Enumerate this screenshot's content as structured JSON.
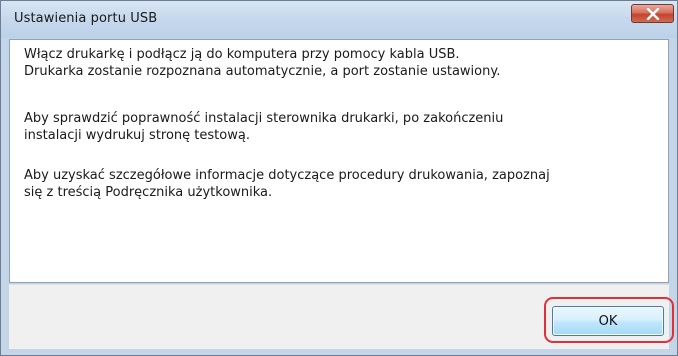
{
  "window": {
    "title": "Ustawienia portu USB"
  },
  "message": {
    "paragraph1_line1": "Włącz drukarkę i podłącz ją do komputera przy pomocy kabla USB.",
    "paragraph1_line2": "Drukarka zostanie rozpoznana automatycznie, a port zostanie ustawiony.",
    "paragraph2_line1": "Aby sprawdzić poprawność instalacji sterownika drukarki, po zakończeniu",
    "paragraph2_line2": "instalacji wydrukuj stronę testową.",
    "paragraph3_line1": "Aby uzyskać szczegółowe informacje dotyczące procedury drukowania, zapoznaj",
    "paragraph3_line2": "się z treścią Podręcznika użytkownika."
  },
  "buttons": {
    "ok_label": "OK"
  },
  "icons": {
    "close": "close-icon"
  },
  "colors": {
    "highlight": "#e0303a",
    "close_button": "#c4432d"
  }
}
